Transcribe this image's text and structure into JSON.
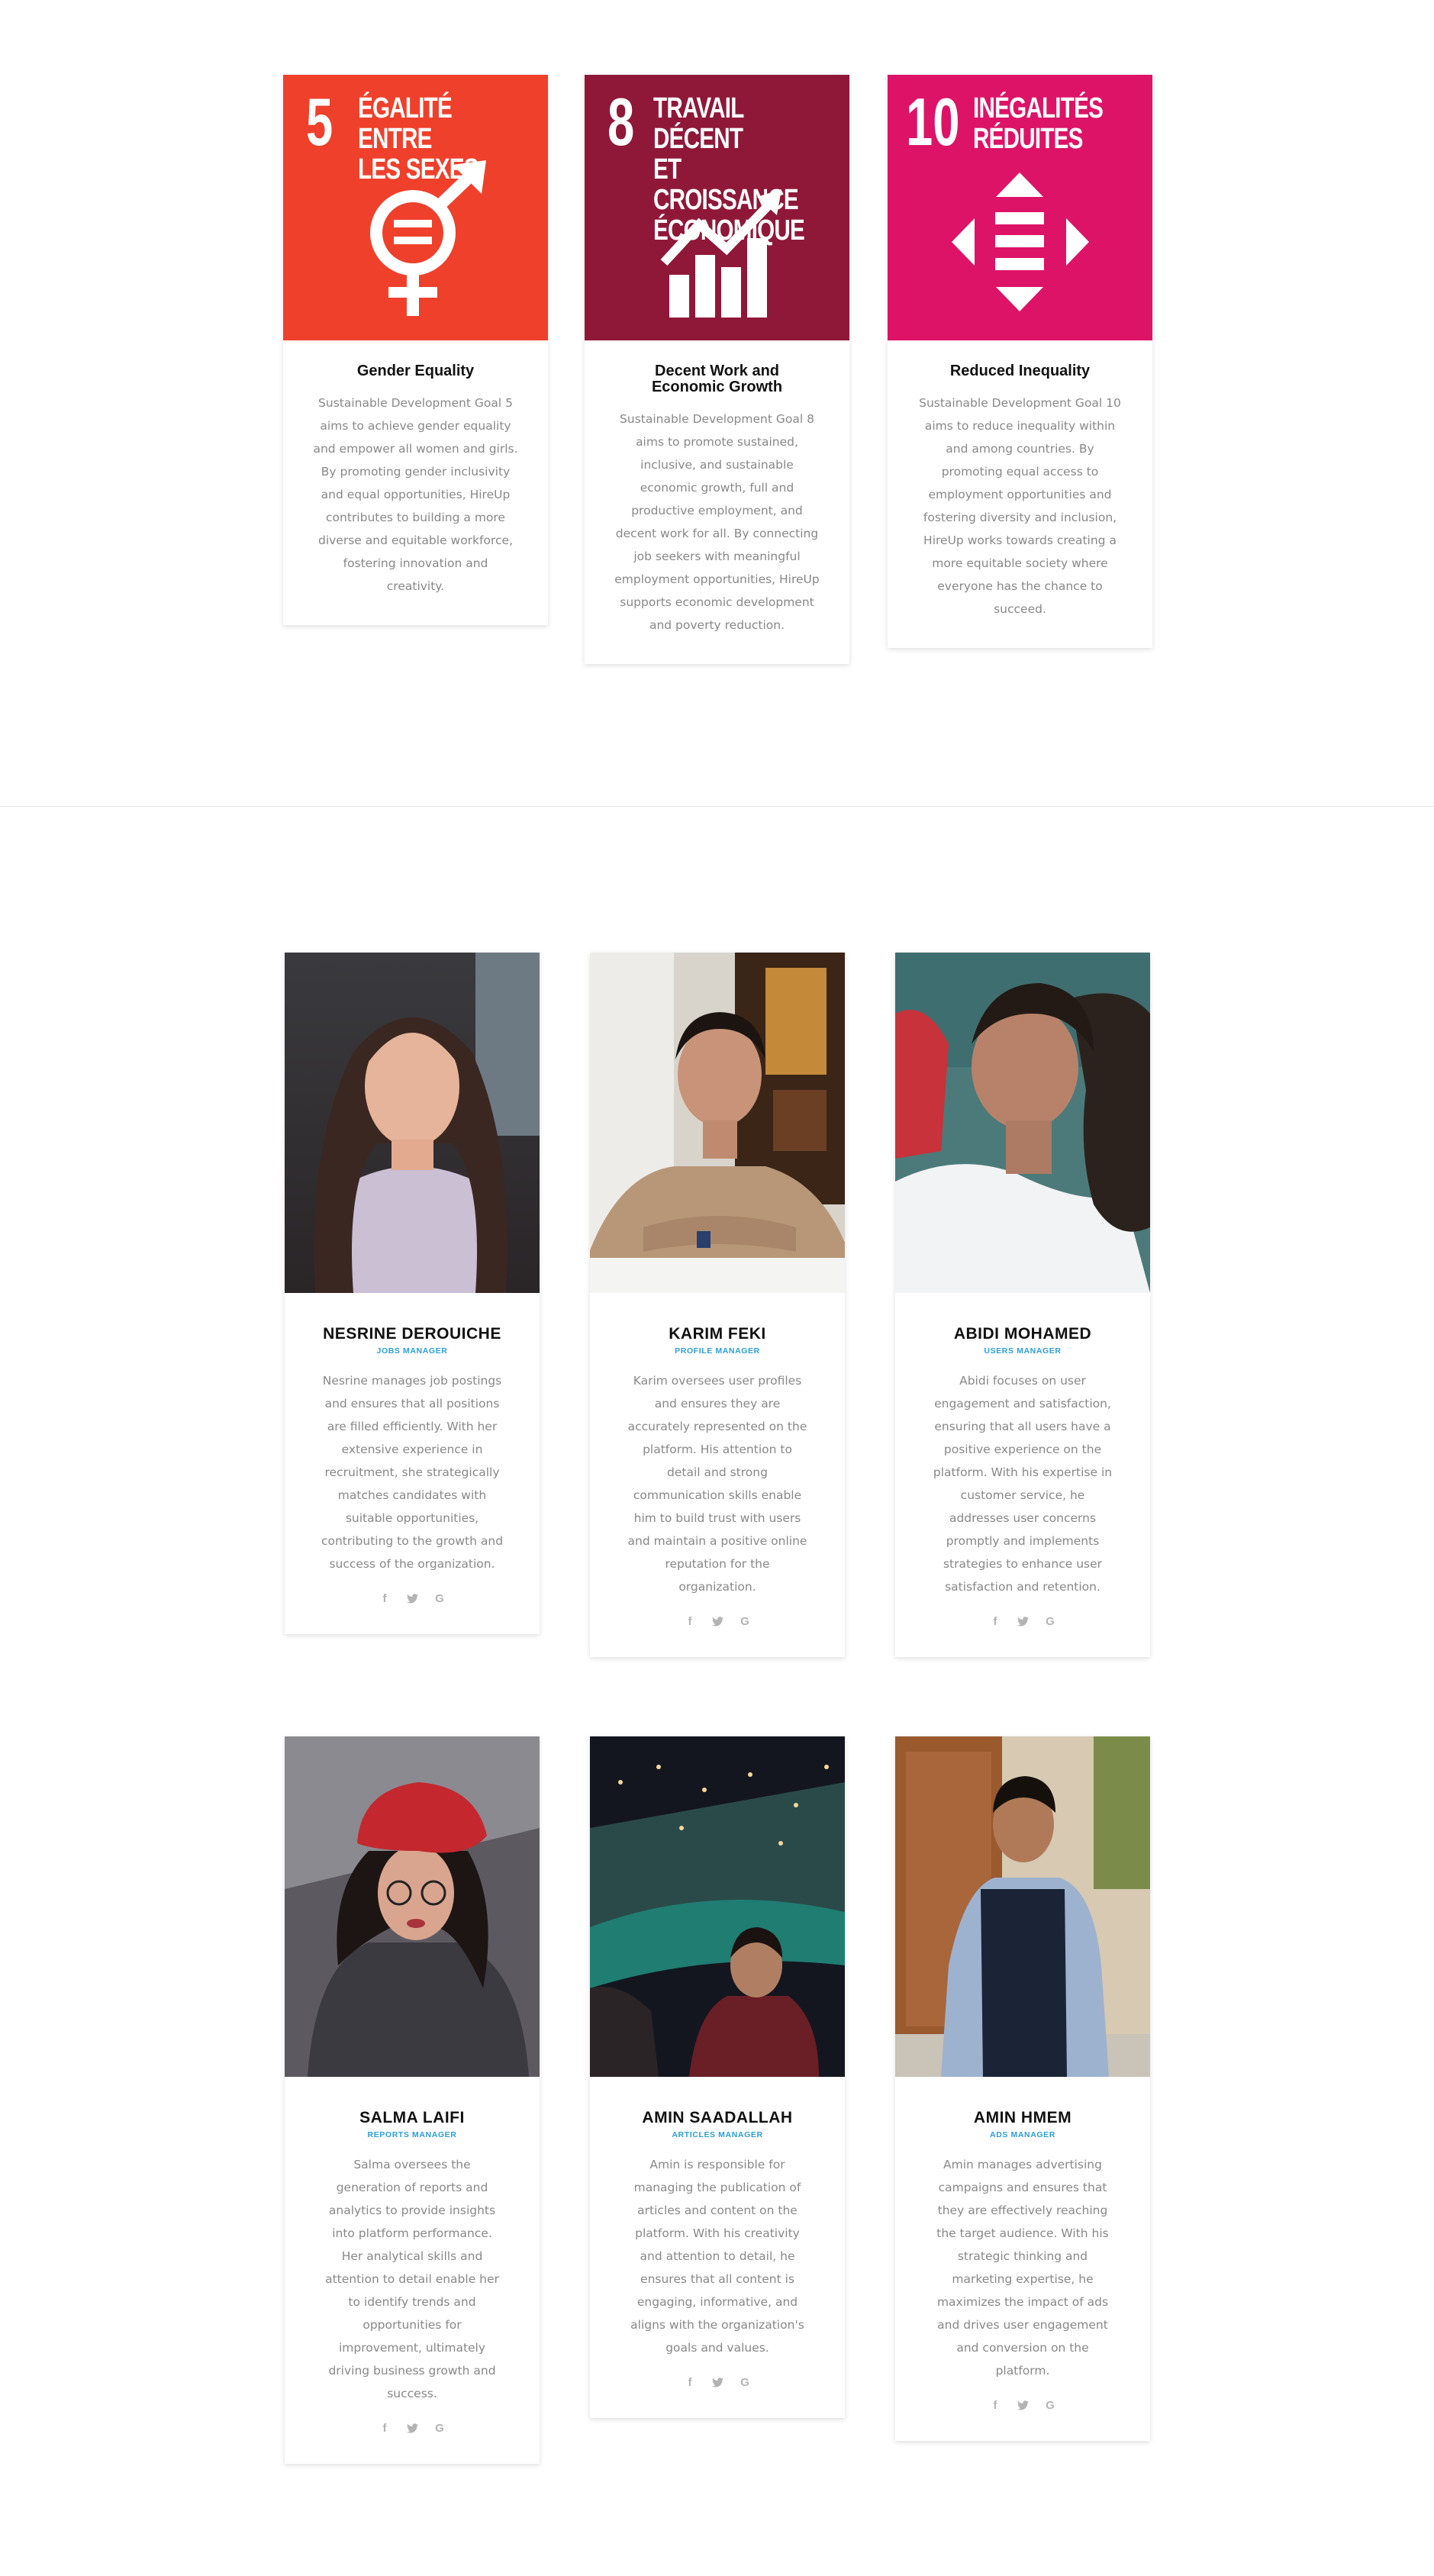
{
  "sdg_cards": [
    {
      "number": "5",
      "label": "ÉGALITÉ ENTRE\nLES SEXES",
      "title": "Gender Equality",
      "text": "Sustainable Development Goal 5 aims to achieve gender equality and empower all women and girls. By promoting gender inclusivity and equal opportunities, HireUp contributes to building a more diverse and equitable workforce, fostering innovation and creativity.",
      "color": "#ef402b",
      "icon": "gender-equality-icon"
    },
    {
      "number": "8",
      "label": "TRAVAIL DÉCENT\nET CROISSANCE\nÉCONOMIQUE",
      "title": "Decent Work and Economic Growth",
      "text": "Sustainable Development Goal 8 aims to promote sustained, inclusive, and sustainable economic growth, full and productive employment, and decent work for all. By connecting job seekers with meaningful employment opportunities, HireUp supports economic development and poverty reduction.",
      "color": "#8f1838",
      "icon": "growth-chart-icon"
    },
    {
      "number": "10",
      "label": "INÉGALITÉS\nRÉDUITES",
      "title": "Reduced Inequality",
      "text": "Sustainable Development Goal 10 aims to reduce inequality within and among countries. By promoting equal access to employment opportunities and fostering diversity and inclusion, HireUp works towards creating a more equitable society where everyone has the chance to succeed.",
      "color": "#dd1367",
      "icon": "reduced-inequality-icon"
    }
  ],
  "team": [
    {
      "name": "NESRINE DEROUICHE",
      "role": "JOBS MANAGER",
      "bio": "Nesrine manages job postings and ensures that all positions are filled efficiently. With her extensive experience in recruitment, she strategically matches candidates with suitable opportunities, contributing to the growth and success of the organization."
    },
    {
      "name": "KARIM FEKI",
      "role": "PROFILE MANAGER",
      "bio": "Karim oversees user profiles and ensures they are accurately represented on the platform. His attention to detail and strong communication skills enable him to build trust with users and maintain a positive online reputation for the organization."
    },
    {
      "name": "ABIDI MOHAMED",
      "role": "USERS MANAGER",
      "bio": "Abidi focuses on user engagement and satisfaction, ensuring that all users have a positive experience on the platform. With his expertise in customer service, he addresses user concerns promptly and implements strategies to enhance user satisfaction and retention."
    },
    {
      "name": "SALMA LAIFI",
      "role": "REPORTS MANAGER",
      "bio": "Salma oversees the generation of reports and analytics to provide insights into platform performance. Her analytical skills and attention to detail enable her to identify trends and opportunities for improvement, ultimately driving business growth and success."
    },
    {
      "name": "AMIN SAADALLAH",
      "role": "ARTICLES MANAGER",
      "bio": "Amin is responsible for managing the publication of articles and content on the platform. With his creativity and attention to detail, he ensures that all content is engaging, informative, and aligns with the organization's goals and values."
    },
    {
      "name": "AMIN HMEM",
      "role": "ADS MANAGER",
      "bio": "Amin manages advertising campaigns and ensures that they are effectively reaching the target audience. With his strategic thinking and marketing expertise, he maximizes the impact of ads and drives user engagement and conversion on the platform."
    }
  ],
  "social": {
    "facebook": "f",
    "google": "G"
  }
}
